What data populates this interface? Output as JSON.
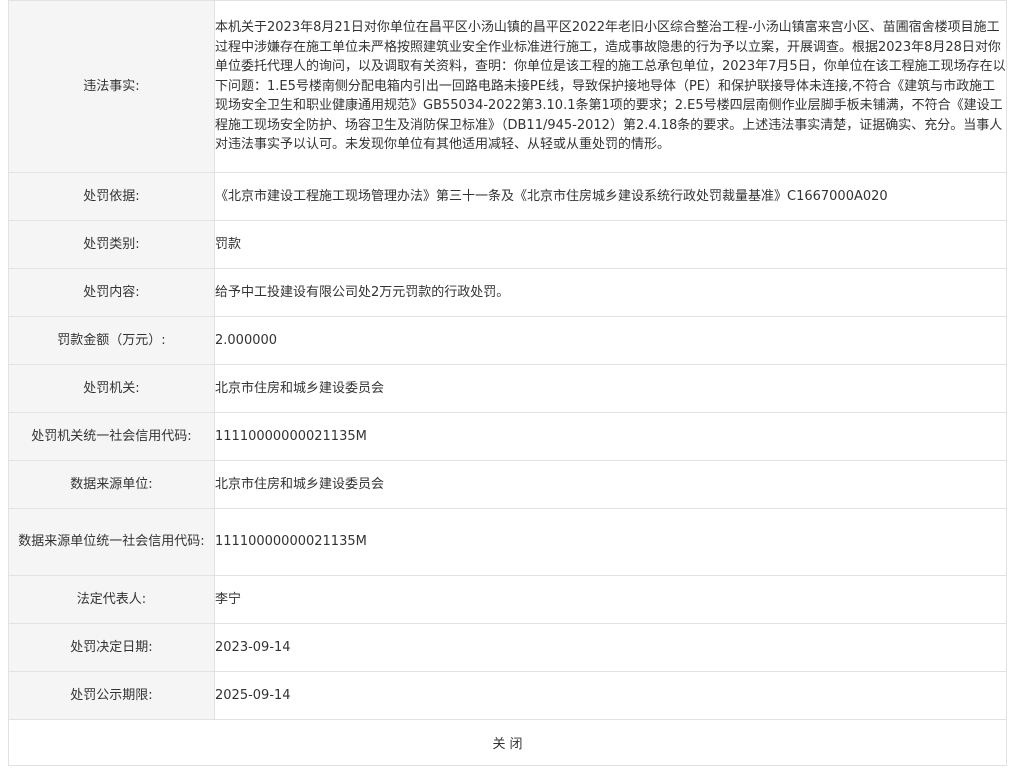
{
  "rows": [
    {
      "label": "违法事实:",
      "value": "本机关于2023年8月21日对你单位在昌平区小汤山镇的昌平区2022年老旧小区综合整治工程-小汤山镇富来宫小区、苗圃宿舍楼项目施工过程中涉嫌存在施工单位未严格按照建筑业安全作业标准进行施工，造成事故隐患的行为予以立案，开展调查。根据2023年8月28日对你单位委托代理人的询问，以及调取有关资料，查明：你单位是该工程的施工总承包单位，2023年7月5日，你单位在该工程施工现场存在以下问题：1.E5号楼南侧分配电箱内引出一回路电路未接PE线，导致保护接地导体（PE）和保护联接导体未连接,不符合《建筑与市政施工现场安全卫生和职业健康通用规范》GB55034-2022第3.10.1条第1项的要求；2.E5号楼四层南侧作业层脚手板未铺满，不符合《建设工程施工现场安全防护、场容卫生及消防保卫标准》（DB11/945-2012）第2.4.18条的要求。上述违法事实清楚，证据确实、充分。当事人对违法事实予以认可。未发现你单位有其他适用减轻、从轻或从重处罚的情形。"
    },
    {
      "label": "处罚依据:",
      "value": "《北京市建设工程施工现场管理办法》第三十一条及《北京市住房城乡建设系统行政处罚裁量基准》C1667000A020"
    },
    {
      "label": "处罚类别:",
      "value": "罚款"
    },
    {
      "label": "处罚内容:",
      "value": "给予中工投建设有限公司处2万元罚款的行政处罚。"
    },
    {
      "label": "罚款金额（万元）:",
      "value": "2.000000"
    },
    {
      "label": "处罚机关:",
      "value": "北京市住房和城乡建设委员会"
    },
    {
      "label": "处罚机关统一社会信用代码:",
      "value": "11110000000021135M"
    },
    {
      "label": "数据来源单位:",
      "value": "北京市住房和城乡建设委员会"
    },
    {
      "label": "数据来源单位统一社会信用代码:",
      "value": "11110000000021135M"
    },
    {
      "label": "法定代表人:",
      "value": "李宁"
    },
    {
      "label": "处罚决定日期:",
      "value": "2023-09-14"
    },
    {
      "label": "处罚公示期限:",
      "value": "2025-09-14"
    }
  ],
  "footer": {
    "close_label": "关闭"
  },
  "colors": {
    "label_bg": "#f5f5f5",
    "border": "#e2e2e2",
    "text": "#333333"
  }
}
